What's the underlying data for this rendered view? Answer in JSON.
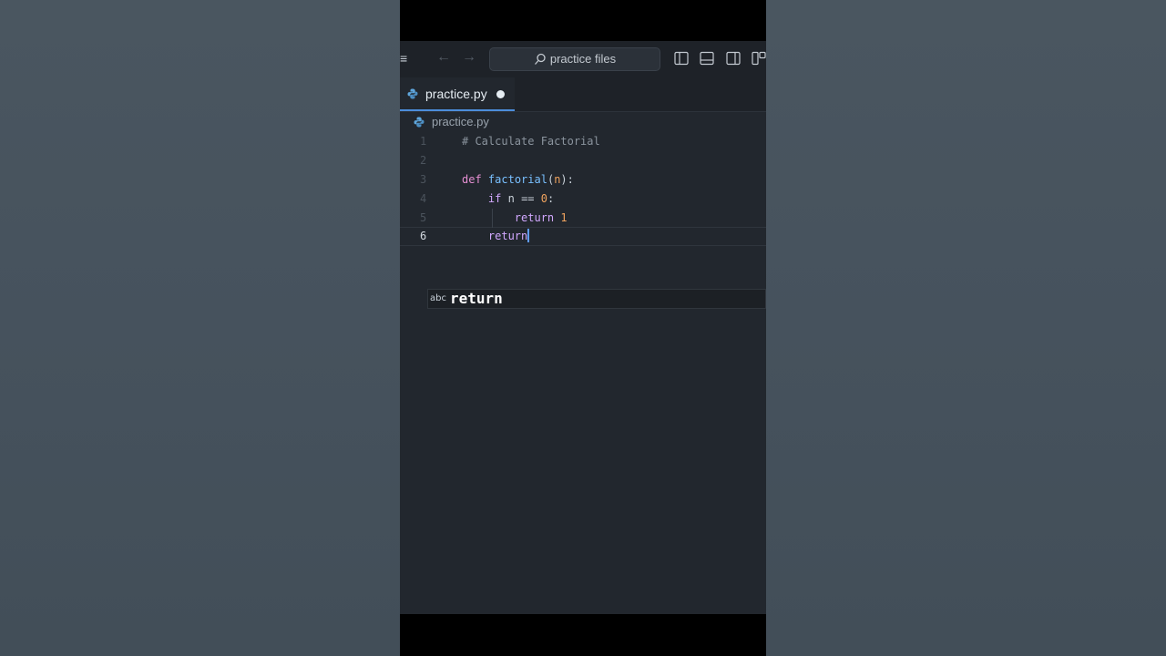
{
  "titlebar": {
    "search_label": "practice files"
  },
  "tab": {
    "label": "practice.py",
    "modified": true
  },
  "breadcrumb": {
    "file": "practice.py"
  },
  "editor": {
    "current_line": 6,
    "lines": [
      {
        "num": "1",
        "text": "# Calculate Factorial"
      },
      {
        "num": "2",
        "text": ""
      },
      {
        "num": "3",
        "text": "def factorial(n):"
      },
      {
        "num": "4",
        "text": "    if n == 0:"
      },
      {
        "num": "5",
        "text": "        return 1"
      },
      {
        "num": "6",
        "text": "    return"
      }
    ]
  },
  "suggest": {
    "kind": "abc",
    "label": "return"
  },
  "colors": {
    "accent": "#4c8ddb",
    "editor_bg": "#22272e",
    "keyword": "#d2a8ff",
    "function": "#79c0ff",
    "number": "#f0a35e",
    "comment": "#8b949e"
  }
}
